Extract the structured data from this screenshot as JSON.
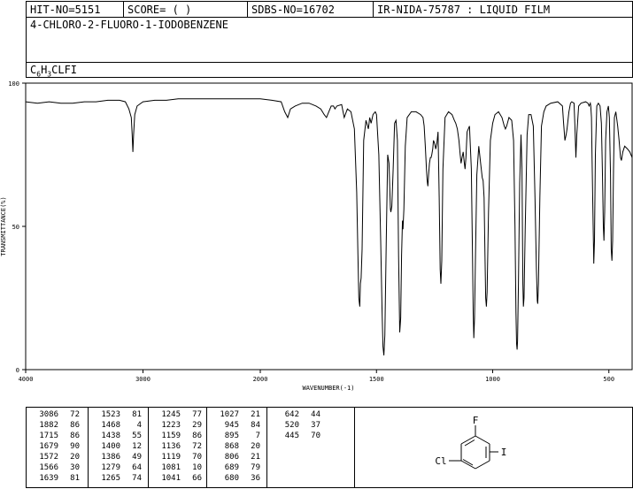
{
  "header": {
    "hit_no": "HIT-NO=5151",
    "score": "SCORE=  (   )",
    "sdbs_no": "SDBS-NO=16702",
    "ir_code": "IR-NIDA-75787 : LIQUID FILM"
  },
  "compound": {
    "name": "4-CHLORO-2-FLUORO-1-IODOBENZENE",
    "formula_parts": [
      "C",
      "6",
      "H",
      "3",
      "CLFI"
    ]
  },
  "structure": {
    "labels": {
      "fluoro": "F",
      "chloro": "Cl",
      "iodo": "I"
    }
  },
  "peak_table": {
    "columns": [
      [
        [
          "3086",
          "72"
        ],
        [
          "1882",
          "86"
        ],
        [
          "1715",
          "86"
        ],
        [
          "1679",
          "90"
        ],
        [
          "1572",
          "20"
        ],
        [
          "1566",
          "30"
        ],
        [
          "1639",
          "81"
        ]
      ],
      [
        [
          "1523",
          "81"
        ],
        [
          "1468",
          "4"
        ],
        [
          "1438",
          "55"
        ],
        [
          "1400",
          "12"
        ],
        [
          "1386",
          "49"
        ],
        [
          "1279",
          "64"
        ],
        [
          "1265",
          "74"
        ]
      ],
      [
        [
          "1245",
          "77"
        ],
        [
          "1223",
          "29"
        ],
        [
          "1159",
          "86"
        ],
        [
          "1136",
          "72"
        ],
        [
          "1119",
          "70"
        ],
        [
          "1081",
          "10"
        ],
        [
          "1041",
          "66"
        ]
      ],
      [
        [
          "1027",
          "21"
        ],
        [
          "945",
          "84"
        ],
        [
          "895",
          "7"
        ],
        [
          "868",
          "20"
        ],
        [
          "806",
          "21"
        ],
        [
          "689",
          "79"
        ],
        [
          "680",
          "36"
        ]
      ],
      [
        [
          "642",
          "44"
        ],
        [
          "520",
          "37"
        ],
        [
          "445",
          "70"
        ]
      ]
    ]
  },
  "chart_data": {
    "type": "line",
    "title": "",
    "xlabel": "WAVENUMBER(-1)",
    "ylabel": "TRANSMITTANCE(%)",
    "xlim": [
      4000,
      400
    ],
    "ylim": [
      0,
      100
    ],
    "x_ticks": [
      4000,
      3000,
      2000,
      1500,
      1000,
      500
    ],
    "x_tick_labels": [
      "4000",
      "3000",
      "2000",
      "1500",
      "1000",
      "500"
    ],
    "y_ticks": [
      0,
      50,
      100
    ],
    "y_tick_labels": [
      "0",
      "50",
      "100"
    ],
    "x_scale_note": "two linear segments split at 2000",
    "series": [
      {
        "name": "",
        "color": "#000000",
        "points": [
          [
            4000,
            93.5
          ],
          [
            3900,
            93
          ],
          [
            3800,
            93.5
          ],
          [
            3700,
            93
          ],
          [
            3600,
            93
          ],
          [
            3500,
            93.5
          ],
          [
            3400,
            93.5
          ],
          [
            3300,
            94
          ],
          [
            3200,
            94
          ],
          [
            3150,
            93.5
          ],
          [
            3120,
            91
          ],
          [
            3100,
            88
          ],
          [
            3092,
            82
          ],
          [
            3086,
            76
          ],
          [
            3080,
            82
          ],
          [
            3070,
            89
          ],
          [
            3050,
            92
          ],
          [
            3000,
            93.5
          ],
          [
            2900,
            94
          ],
          [
            2800,
            94
          ],
          [
            2700,
            94.5
          ],
          [
            2600,
            94.5
          ],
          [
            2500,
            94.5
          ],
          [
            2400,
            94.5
          ],
          [
            2300,
            94.5
          ],
          [
            2200,
            94.5
          ],
          [
            2100,
            94.5
          ],
          [
            2000,
            94.5
          ],
          [
            1950,
            94
          ],
          [
            1910,
            93.5
          ],
          [
            1895,
            90
          ],
          [
            1882,
            88
          ],
          [
            1870,
            91
          ],
          [
            1850,
            92
          ],
          [
            1820,
            93
          ],
          [
            1790,
            93
          ],
          [
            1760,
            92
          ],
          [
            1740,
            91
          ],
          [
            1725,
            89
          ],
          [
            1715,
            88
          ],
          [
            1705,
            90
          ],
          [
            1695,
            92
          ],
          [
            1685,
            92
          ],
          [
            1679,
            91
          ],
          [
            1670,
            92
          ],
          [
            1650,
            92.5
          ],
          [
            1639,
            88
          ],
          [
            1625,
            91
          ],
          [
            1610,
            90
          ],
          [
            1595,
            84
          ],
          [
            1585,
            62
          ],
          [
            1580,
            40
          ],
          [
            1576,
            25
          ],
          [
            1572,
            22
          ],
          [
            1569,
            30
          ],
          [
            1566,
            32
          ],
          [
            1562,
            42
          ],
          [
            1555,
            80
          ],
          [
            1545,
            87
          ],
          [
            1535,
            84
          ],
          [
            1529,
            88
          ],
          [
            1523,
            86
          ],
          [
            1515,
            89
          ],
          [
            1505,
            90
          ],
          [
            1500,
            89
          ],
          [
            1490,
            75
          ],
          [
            1482,
            45
          ],
          [
            1476,
            20
          ],
          [
            1472,
            8
          ],
          [
            1468,
            5
          ],
          [
            1464,
            12
          ],
          [
            1458,
            45
          ],
          [
            1452,
            75
          ],
          [
            1446,
            72
          ],
          [
            1440,
            56
          ],
          [
            1438,
            55
          ],
          [
            1434,
            57
          ],
          [
            1428,
            70
          ],
          [
            1422,
            86
          ],
          [
            1416,
            87
          ],
          [
            1410,
            80
          ],
          [
            1405,
            40
          ],
          [
            1400,
            13
          ],
          [
            1396,
            18
          ],
          [
            1392,
            40
          ],
          [
            1388,
            52
          ],
          [
            1386,
            49
          ],
          [
            1382,
            56
          ],
          [
            1376,
            78
          ],
          [
            1368,
            88
          ],
          [
            1350,
            90
          ],
          [
            1330,
            90
          ],
          [
            1310,
            89
          ],
          [
            1300,
            88
          ],
          [
            1295,
            85
          ],
          [
            1290,
            78
          ],
          [
            1285,
            70
          ],
          [
            1282,
            66
          ],
          [
            1279,
            64
          ],
          [
            1276,
            68
          ],
          [
            1272,
            72
          ],
          [
            1268,
            74
          ],
          [
            1265,
            74
          ],
          [
            1262,
            75
          ],
          [
            1258,
            77
          ],
          [
            1255,
            80
          ],
          [
            1250,
            79
          ],
          [
            1245,
            77
          ],
          [
            1240,
            79
          ],
          [
            1235,
            83
          ],
          [
            1230,
            60
          ],
          [
            1226,
            35
          ],
          [
            1223,
            30
          ],
          [
            1219,
            38
          ],
          [
            1214,
            70
          ],
          [
            1205,
            88
          ],
          [
            1190,
            90
          ],
          [
            1175,
            89
          ],
          [
            1165,
            87
          ],
          [
            1159,
            86
          ],
          [
            1152,
            84
          ],
          [
            1145,
            80
          ],
          [
            1140,
            75
          ],
          [
            1136,
            72
          ],
          [
            1132,
            74
          ],
          [
            1127,
            76
          ],
          [
            1122,
            72
          ],
          [
            1119,
            70
          ],
          [
            1115,
            74
          ],
          [
            1110,
            83
          ],
          [
            1100,
            85
          ],
          [
            1092,
            70
          ],
          [
            1087,
            40
          ],
          [
            1084,
            20
          ],
          [
            1081,
            11
          ],
          [
            1078,
            18
          ],
          [
            1074,
            40
          ],
          [
            1068,
            68
          ],
          [
            1060,
            78
          ],
          [
            1052,
            72
          ],
          [
            1045,
            67
          ],
          [
            1041,
            66
          ],
          [
            1037,
            60
          ],
          [
            1033,
            40
          ],
          [
            1030,
            25
          ],
          [
            1027,
            22
          ],
          [
            1024,
            27
          ],
          [
            1018,
            55
          ],
          [
            1010,
            80
          ],
          [
            1000,
            86
          ],
          [
            990,
            89
          ],
          [
            975,
            90
          ],
          [
            960,
            88
          ],
          [
            950,
            85
          ],
          [
            945,
            84
          ],
          [
            940,
            85
          ],
          [
            930,
            88
          ],
          [
            918,
            87
          ],
          [
            910,
            80
          ],
          [
            904,
            50
          ],
          [
            900,
            20
          ],
          [
            897,
            9
          ],
          [
            895,
            7
          ],
          [
            893,
            10
          ],
          [
            889,
            30
          ],
          [
            884,
            65
          ],
          [
            878,
            82
          ],
          [
            874,
            70
          ],
          [
            870,
            30
          ],
          [
            868,
            22
          ],
          [
            865,
            25
          ],
          [
            860,
            50
          ],
          [
            852,
            82
          ],
          [
            845,
            89
          ],
          [
            835,
            89
          ],
          [
            825,
            85
          ],
          [
            818,
            60
          ],
          [
            812,
            35
          ],
          [
            808,
            24
          ],
          [
            806,
            23
          ],
          [
            803,
            30
          ],
          [
            797,
            60
          ],
          [
            790,
            85
          ],
          [
            780,
            90
          ],
          [
            770,
            92
          ],
          [
            750,
            93
          ],
          [
            720,
            93.5
          ],
          [
            700,
            92
          ],
          [
            695,
            86
          ],
          [
            689,
            80
          ],
          [
            684,
            82
          ],
          [
            680,
            84
          ],
          [
            672,
            90
          ],
          [
            665,
            93
          ],
          [
            660,
            93.5
          ],
          [
            650,
            93
          ],
          [
            646,
            85
          ],
          [
            642,
            74
          ],
          [
            638,
            82
          ],
          [
            630,
            92
          ],
          [
            620,
            93
          ],
          [
            600,
            93.5
          ],
          [
            590,
            93
          ],
          [
            585,
            92
          ],
          [
            580,
            93
          ],
          [
            578,
            92
          ],
          [
            575,
            88
          ],
          [
            572,
            73
          ],
          [
            568,
            52
          ],
          [
            565,
            37
          ],
          [
            562,
            45
          ],
          [
            558,
            75
          ],
          [
            552,
            92
          ],
          [
            545,
            93
          ],
          [
            538,
            92
          ],
          [
            532,
            86
          ],
          [
            528,
            70
          ],
          [
            524,
            50
          ],
          [
            521,
            45
          ],
          [
            518,
            55
          ],
          [
            514,
            80
          ],
          [
            508,
            90
          ],
          [
            502,
            92
          ],
          [
            498,
            88
          ],
          [
            493,
            68
          ],
          [
            490,
            42
          ],
          [
            487,
            38
          ],
          [
            484,
            45
          ],
          [
            480,
            70
          ],
          [
            476,
            88
          ],
          [
            470,
            90
          ],
          [
            462,
            85
          ],
          [
            456,
            80
          ],
          [
            450,
            74
          ],
          [
            446,
            73
          ],
          [
            440,
            76
          ],
          [
            432,
            78
          ],
          [
            420,
            77
          ],
          [
            410,
            76
          ],
          [
            400,
            74
          ]
        ]
      }
    ]
  }
}
